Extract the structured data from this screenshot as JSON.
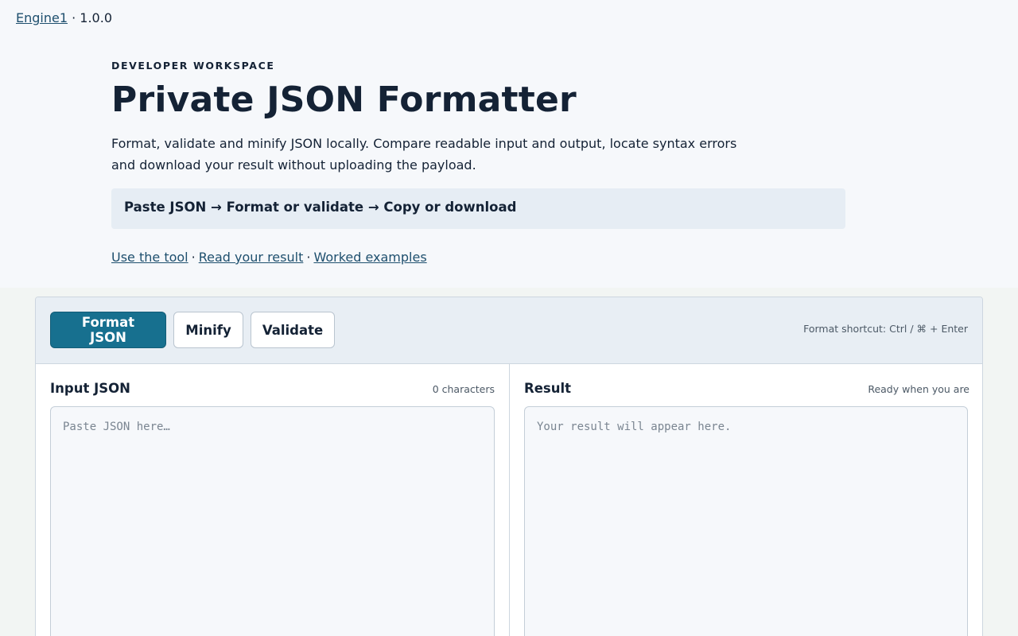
{
  "topbar": {
    "brand": "Engine1",
    "version": "1.0.0"
  },
  "hero": {
    "eyebrow": "DEVELOPER WORKSPACE",
    "title": "Private JSON Formatter",
    "intro": "Format, validate and minify JSON locally. Compare readable input and output, locate syntax errors and download your result without uploading the payload.",
    "steps": "Paste JSON → Format or validate → Copy or download"
  },
  "nav_links": [
    "Use the tool",
    "Read your result",
    "Worked examples"
  ],
  "toolbar": {
    "format_label": "Format JSON",
    "minify_label": "Minify",
    "validate_label": "Validate",
    "shortcut": "Format shortcut: Ctrl / ⌘ + Enter"
  },
  "input_pane": {
    "title": "Input JSON",
    "meta": "0 characters",
    "value": "",
    "placeholder": "Paste JSON here…"
  },
  "result_pane": {
    "title": "Result",
    "meta": "Ready when you are",
    "placeholder": "Your result will appear here."
  },
  "colors": {
    "accent": "#17708f",
    "link": "#1e4f6e",
    "text": "#142235"
  }
}
